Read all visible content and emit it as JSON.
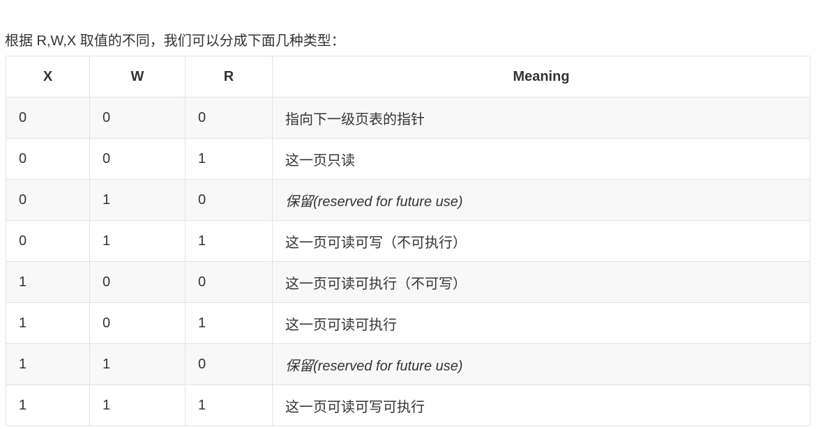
{
  "intro_text": "根据 R,W,X 取值的不同，我们可以分成下面几种类型：",
  "table": {
    "headers": [
      "X",
      "W",
      "R",
      "Meaning"
    ],
    "rows": [
      {
        "x": "0",
        "w": "0",
        "r": "0",
        "meaning": "指向下一级页表的指针",
        "italic": false
      },
      {
        "x": "0",
        "w": "0",
        "r": "1",
        "meaning": "这一页只读",
        "italic": false
      },
      {
        "x": "0",
        "w": "1",
        "r": "0",
        "meaning": "保留(reserved for future use)",
        "italic": true
      },
      {
        "x": "0",
        "w": "1",
        "r": "1",
        "meaning": "这一页可读可写（不可执行）",
        "italic": false
      },
      {
        "x": "1",
        "w": "0",
        "r": "0",
        "meaning": "这一页可读可执行（不可写）",
        "italic": false
      },
      {
        "x": "1",
        "w": "0",
        "r": "1",
        "meaning": "这一页可读可执行",
        "italic": false
      },
      {
        "x": "1",
        "w": "1",
        "r": "0",
        "meaning": "保留(reserved for future use)",
        "italic": true
      },
      {
        "x": "1",
        "w": "1",
        "r": "1",
        "meaning": "这一页可读可写可执行",
        "italic": false
      }
    ]
  },
  "colors": {
    "text": "#333333",
    "border": "#dfe2e5",
    "row_stripe": "#f8f8f8",
    "background": "#ffffff"
  }
}
